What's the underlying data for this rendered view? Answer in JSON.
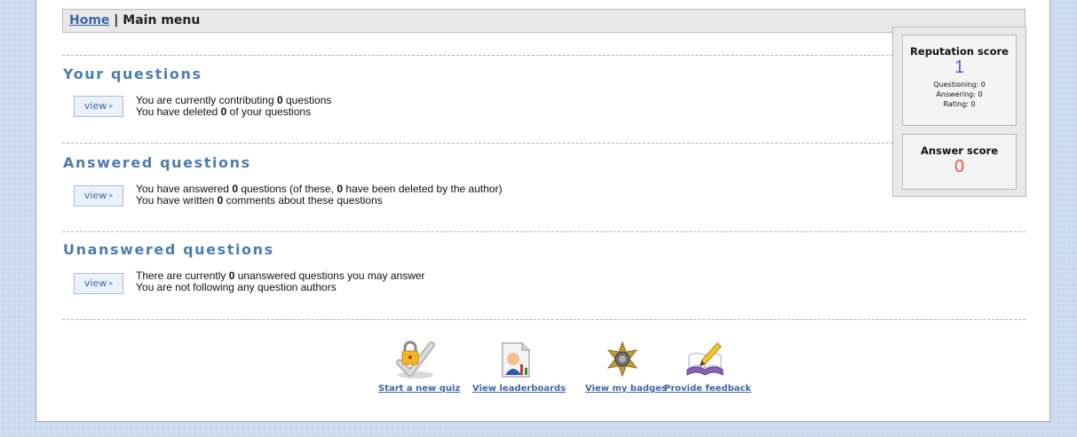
{
  "breadcrumb": {
    "home": "Home",
    "separator": "|",
    "current": "Main menu"
  },
  "sections": [
    {
      "title": "Your questions",
      "button": "view",
      "lines": [
        {
          "pre": "You are currently contributing ",
          "value": "0",
          "post": " questions"
        },
        {
          "pre": "You have deleted ",
          "value": "0",
          "post": " of your questions"
        }
      ]
    },
    {
      "title": "Answered questions",
      "button": "view",
      "lines": [
        {
          "pre": "You have answered ",
          "value": "0",
          "mid": " questions (of these, ",
          "value2": "0",
          "post": " have been deleted by the author)"
        },
        {
          "pre": "You have written ",
          "value": "0",
          "post": " comments about these questions"
        }
      ]
    },
    {
      "title": "Unanswered questions",
      "button": "view",
      "lines": [
        {
          "pre": "There are currently ",
          "value": "0",
          "post": " unanswered questions you may answer"
        },
        {
          "pre": "You are not following any question authors"
        }
      ]
    }
  ],
  "reputation": {
    "title": "Reputation score",
    "value": "1",
    "color": "#5b5bd6",
    "questioning": "Questioning: 0",
    "answering": "Answering: 0",
    "rating": "Rating: 0"
  },
  "answer": {
    "title": "Answer score",
    "value": "0",
    "color": "#ff4f4f"
  },
  "nav": [
    {
      "label": "Start a new quiz",
      "icon": "checkmark-lock-icon"
    },
    {
      "label": "View leaderboards",
      "icon": "leaderboard-icon"
    },
    {
      "label": "View my badges",
      "icon": "sheriff-badge-icon"
    },
    {
      "label": "Provide feedback",
      "icon": "book-pencil-icon"
    }
  ]
}
